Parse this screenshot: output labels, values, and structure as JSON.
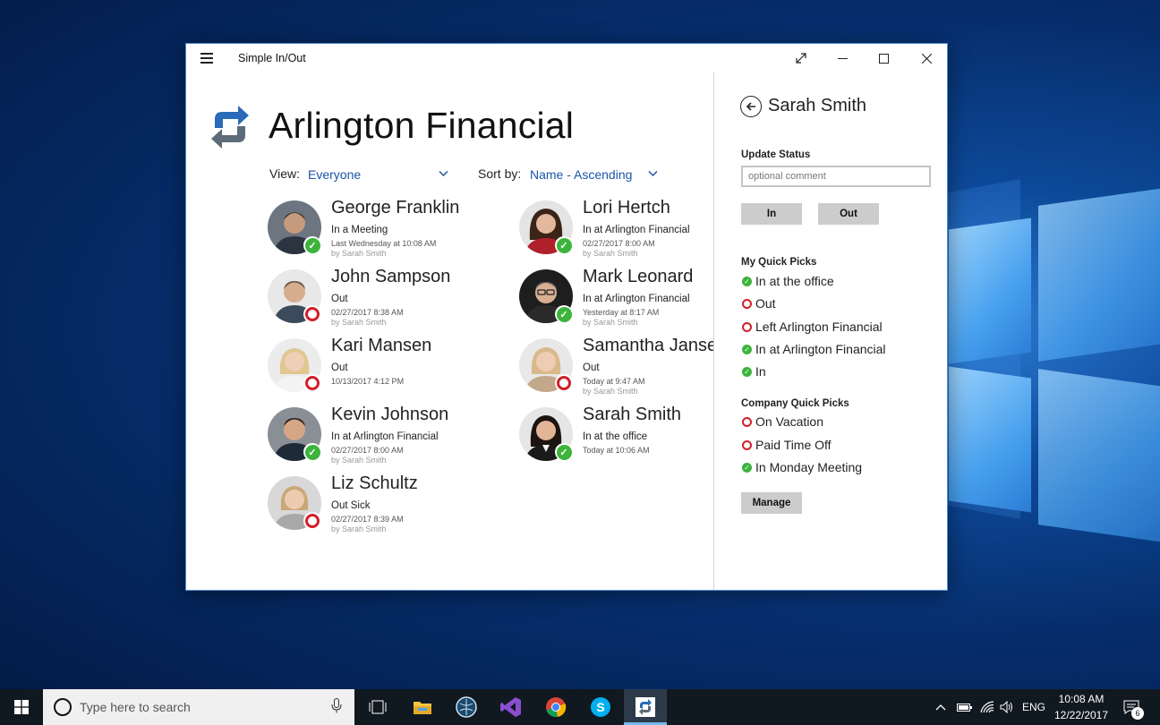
{
  "window": {
    "title": "Simple In/Out"
  },
  "header": {
    "org_name": "Arlington Financial",
    "view_label": "View:",
    "view_value": "Everyone",
    "sort_label": "Sort by:",
    "sort_value": "Name - Ascending"
  },
  "people": [
    {
      "name": "George Franklin",
      "status": "In a Meeting",
      "time": "Last Wednesday at 10:08 AM",
      "by": "by Sarah Smith",
      "state": "in"
    },
    {
      "name": "John Sampson",
      "status": "Out",
      "time": "02/27/2017 8:38 AM",
      "by": "by Sarah Smith",
      "state": "out"
    },
    {
      "name": "Kari Mansen",
      "status": "Out",
      "time": "10/13/2017 4:12 PM",
      "by": "",
      "state": "out"
    },
    {
      "name": "Kevin Johnson",
      "status": "In at Arlington Financial",
      "time": "02/27/2017 8:00 AM",
      "by": "by Sarah Smith",
      "state": "in"
    },
    {
      "name": "Liz Schultz",
      "status": "Out Sick",
      "time": "02/27/2017 8:39 AM",
      "by": "by Sarah Smith",
      "state": "out"
    },
    {
      "name": "Lori Hertch",
      "status": "In at Arlington Financial",
      "time": "02/27/2017 8:00 AM",
      "by": "by Sarah Smith",
      "state": "in"
    },
    {
      "name": "Mark Leonard",
      "status": "In at Arlington Financial",
      "time": "Yesterday at 8:17 AM",
      "by": "by Sarah Smith",
      "state": "in"
    },
    {
      "name": "Samantha Jansen",
      "status": "Out",
      "time": "Today at 9:47 AM",
      "by": "by Sarah Smith",
      "state": "out"
    },
    {
      "name": "Sarah Smith",
      "status": "In at the office",
      "time": "Today at 10:06 AM",
      "by": "",
      "state": "in"
    }
  ],
  "panel": {
    "name": "Sarah Smith",
    "update_status_label": "Update Status",
    "comment_placeholder": "optional comment",
    "in_button": "In",
    "out_button": "Out",
    "my_quick_picks_label": "My Quick Picks",
    "my_quick_picks": [
      {
        "label": "In at the office",
        "state": "in"
      },
      {
        "label": "Out",
        "state": "out"
      },
      {
        "label": "Left Arlington Financial",
        "state": "out"
      },
      {
        "label": "In at Arlington Financial",
        "state": "in"
      },
      {
        "label": "In",
        "state": "in"
      }
    ],
    "company_quick_picks_label": "Company Quick Picks",
    "company_quick_picks": [
      {
        "label": "On Vacation",
        "state": "out"
      },
      {
        "label": "Paid Time Off",
        "state": "out"
      },
      {
        "label": "In Monday Meeting",
        "state": "in"
      }
    ],
    "manage_button": "Manage"
  },
  "taskbar": {
    "search_placeholder": "Type here to search",
    "language": "ENG",
    "time": "10:08 AM",
    "date": "12/22/2017",
    "notification_count": "6"
  },
  "colors": {
    "accent": "#1a56a6",
    "status_in": "#3cb43c",
    "status_out": "#d0202a"
  }
}
